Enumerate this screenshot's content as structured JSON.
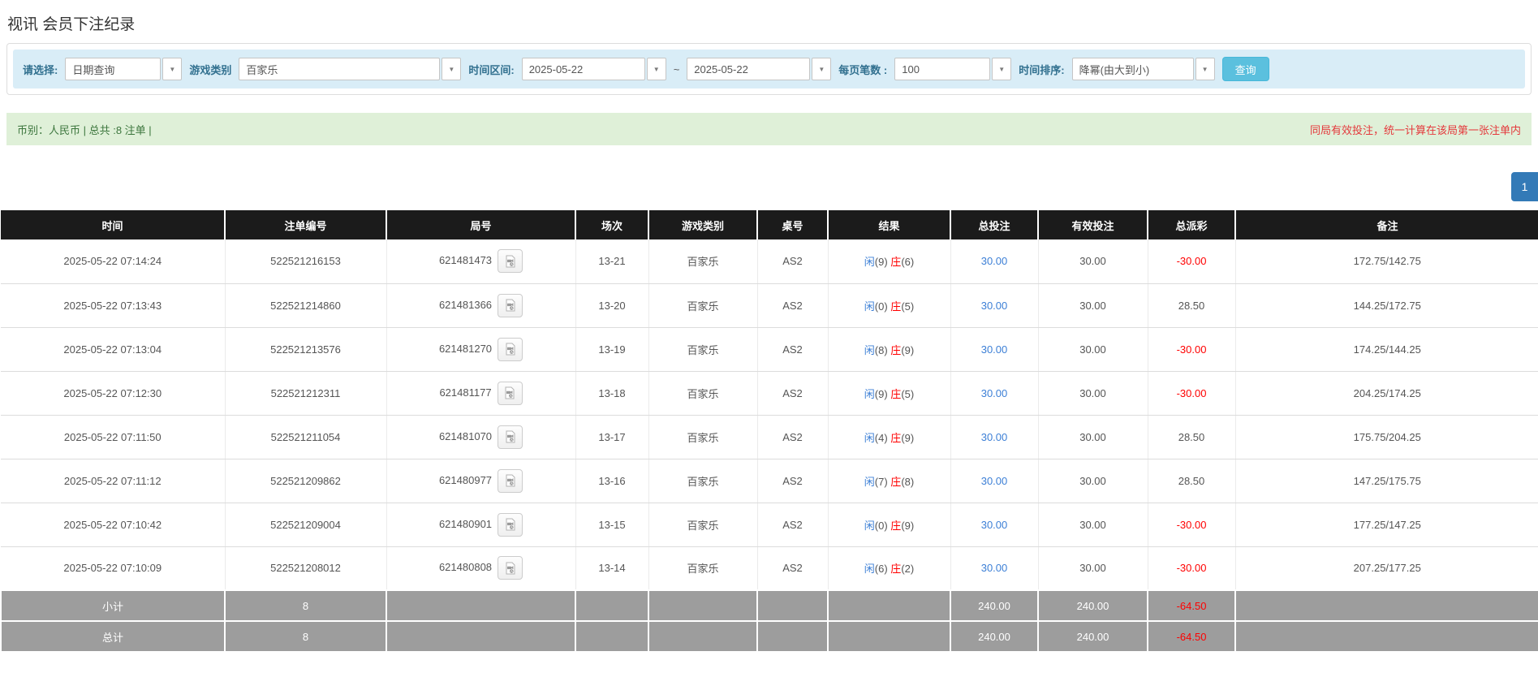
{
  "page": {
    "title": "视讯 会员下注纪录"
  },
  "filters": {
    "select_label": "请选择:",
    "select_value": "日期查询",
    "game_label": "游戏类别",
    "game_value": "百家乐",
    "range_label": "时间区间:",
    "date_from": "2025-05-22",
    "tilde": "~",
    "date_to": "2025-05-22",
    "page_size_label": "每页笔数 :",
    "page_size_value": "100",
    "sort_label": "时间排序:",
    "sort_value": "降幂(由大到小)",
    "search_button": "查询",
    "dropdown_arrow": "▼"
  },
  "summary": {
    "left": "币别：人民币 | 总共 :8 注单 |",
    "right": "同局有效投注，统一计算在该局第一张注单内"
  },
  "pagination": {
    "current_page": "1"
  },
  "table": {
    "headers": [
      "时间",
      "注单编号",
      "局号",
      "场次",
      "游戏类别",
      "桌号",
      "结果",
      "总投注",
      "有效投注",
      "总派彩",
      "备注"
    ],
    "rows": [
      {
        "time": "2025-05-22 07:14:24",
        "bet_id": "522521216153",
        "round_id": "621481473",
        "session": "13-21",
        "game": "百家乐",
        "table_no": "AS2",
        "player_label": "闲",
        "player_score": "(9)",
        "banker_label": "庄",
        "banker_score": "(6)",
        "total_bet": "30.00",
        "valid_bet": "30.00",
        "payout": "-30.00",
        "remark": "172.75/142.75"
      },
      {
        "time": "2025-05-22 07:13:43",
        "bet_id": "522521214860",
        "round_id": "621481366",
        "session": "13-20",
        "game": "百家乐",
        "table_no": "AS2",
        "player_label": "闲",
        "player_score": "(0)",
        "banker_label": "庄",
        "banker_score": "(5)",
        "total_bet": "30.00",
        "valid_bet": "30.00",
        "payout": "28.50",
        "remark": "144.25/172.75"
      },
      {
        "time": "2025-05-22 07:13:04",
        "bet_id": "522521213576",
        "round_id": "621481270",
        "session": "13-19",
        "game": "百家乐",
        "table_no": "AS2",
        "player_label": "闲",
        "player_score": "(8)",
        "banker_label": "庄",
        "banker_score": "(9)",
        "total_bet": "30.00",
        "valid_bet": "30.00",
        "payout": "-30.00",
        "remark": "174.25/144.25"
      },
      {
        "time": "2025-05-22 07:12:30",
        "bet_id": "522521212311",
        "round_id": "621481177",
        "session": "13-18",
        "game": "百家乐",
        "table_no": "AS2",
        "player_label": "闲",
        "player_score": "(9)",
        "banker_label": "庄",
        "banker_score": "(5)",
        "total_bet": "30.00",
        "valid_bet": "30.00",
        "payout": "-30.00",
        "remark": "204.25/174.25"
      },
      {
        "time": "2025-05-22 07:11:50",
        "bet_id": "522521211054",
        "round_id": "621481070",
        "session": "13-17",
        "game": "百家乐",
        "table_no": "AS2",
        "player_label": "闲",
        "player_score": "(4)",
        "banker_label": "庄",
        "banker_score": "(9)",
        "total_bet": "30.00",
        "valid_bet": "30.00",
        "payout": "28.50",
        "remark": "175.75/204.25"
      },
      {
        "time": "2025-05-22 07:11:12",
        "bet_id": "522521209862",
        "round_id": "621480977",
        "session": "13-16",
        "game": "百家乐",
        "table_no": "AS2",
        "player_label": "闲",
        "player_score": "(7)",
        "banker_label": "庄",
        "banker_score": "(8)",
        "total_bet": "30.00",
        "valid_bet": "30.00",
        "payout": "28.50",
        "remark": "147.25/175.75"
      },
      {
        "time": "2025-05-22 07:10:42",
        "bet_id": "522521209004",
        "round_id": "621480901",
        "session": "13-15",
        "game": "百家乐",
        "table_no": "AS2",
        "player_label": "闲",
        "player_score": "(0)",
        "banker_label": "庄",
        "banker_score": "(9)",
        "total_bet": "30.00",
        "valid_bet": "30.00",
        "payout": "-30.00",
        "remark": "177.25/147.25"
      },
      {
        "time": "2025-05-22 07:10:09",
        "bet_id": "522521208012",
        "round_id": "621480808",
        "session": "13-14",
        "game": "百家乐",
        "table_no": "AS2",
        "player_label": "闲",
        "player_score": "(6)",
        "banker_label": "庄",
        "banker_score": "(2)",
        "total_bet": "30.00",
        "valid_bet": "30.00",
        "payout": "-30.00",
        "remark": "207.25/177.25"
      }
    ],
    "subtotal": {
      "label": "小计",
      "count": "8",
      "total_bet": "240.00",
      "valid_bet": "240.00",
      "payout": "-64.50",
      "remark": ""
    },
    "total": {
      "label": "总计",
      "count": "8",
      "total_bet": "240.00",
      "valid_bet": "240.00",
      "payout": "-64.50",
      "remark": ""
    }
  },
  "colors": {
    "link_blue": "#337ab7",
    "result_blue": "#3c7fd6",
    "negative_red": "#ff0000",
    "warn_red": "#e4393c",
    "header_black": "#1b1b1b",
    "footer_gray": "#9d9d9d",
    "button_cyan": "#5bc0de",
    "summary_green_bg": "#dff0d8",
    "summary_green_text": "#3c763d",
    "filter_bar_blue": "#d9edf7"
  }
}
